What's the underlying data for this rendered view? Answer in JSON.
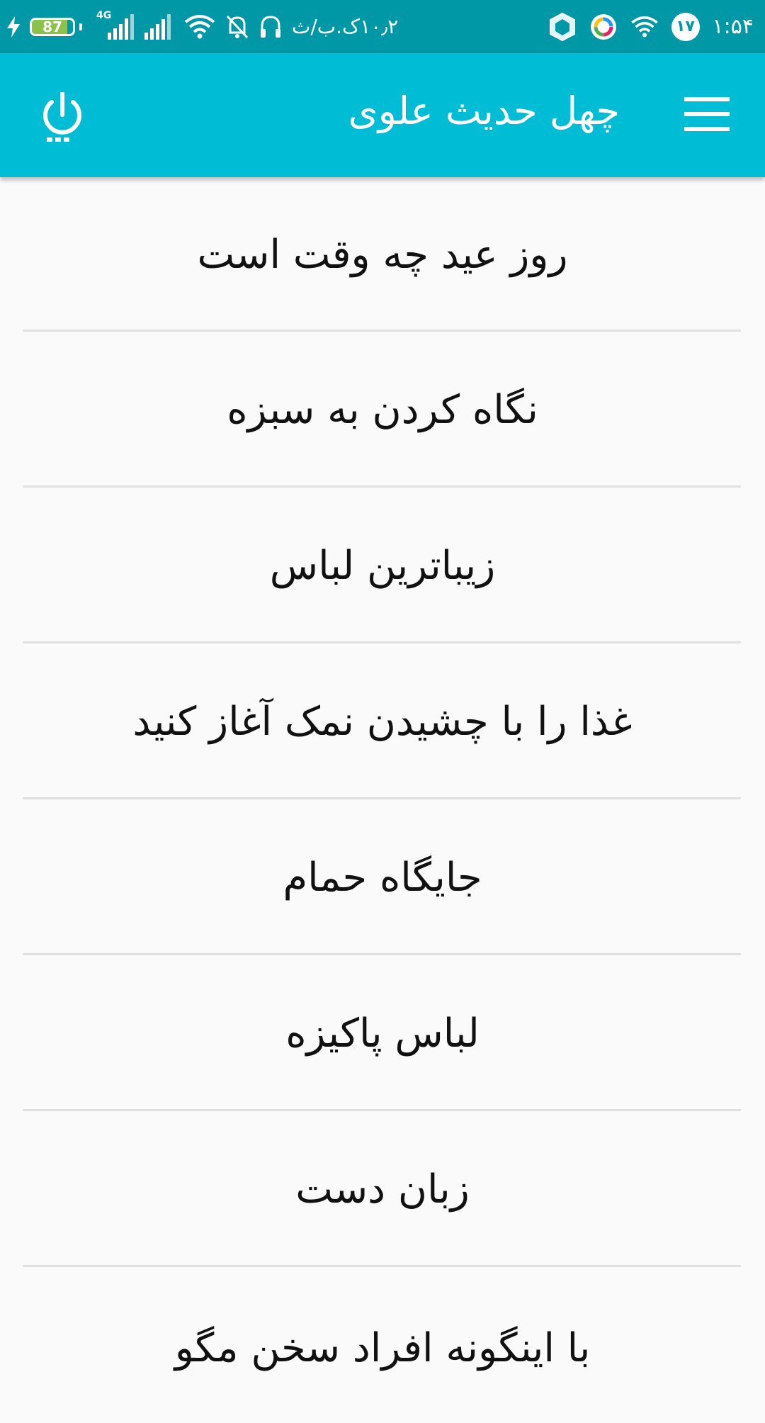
{
  "status_bar": {
    "battery_level": "87",
    "battery_fraction": 0.87,
    "network_type": "4G",
    "speed": "۱۰٫۲ک.ب/ث",
    "notification_count": "۱۷",
    "time": "۱:۵۴"
  },
  "app_bar": {
    "title": "چهل حدیث علوی",
    "menu_icon": "hamburger-menu-icon",
    "power_icon": "power-icon"
  },
  "list": {
    "items": [
      {
        "label": "روز عید چه وقت است"
      },
      {
        "label": "نگاه کردن به سبزه"
      },
      {
        "label": "زیباترین لباس"
      },
      {
        "label": "غذا را با چشیدن نمک آغاز کنید"
      },
      {
        "label": "جایگاه حمام"
      },
      {
        "label": "لباس پاکیزه"
      },
      {
        "label": "زبان دست"
      },
      {
        "label": "با اینگونه افراد سخن مگو"
      }
    ]
  },
  "colors": {
    "status_bar": "#0097a7",
    "app_bar": "#00bcd4",
    "background": "#fafafa",
    "divider": "#e0e0e0",
    "text": "#111111"
  }
}
